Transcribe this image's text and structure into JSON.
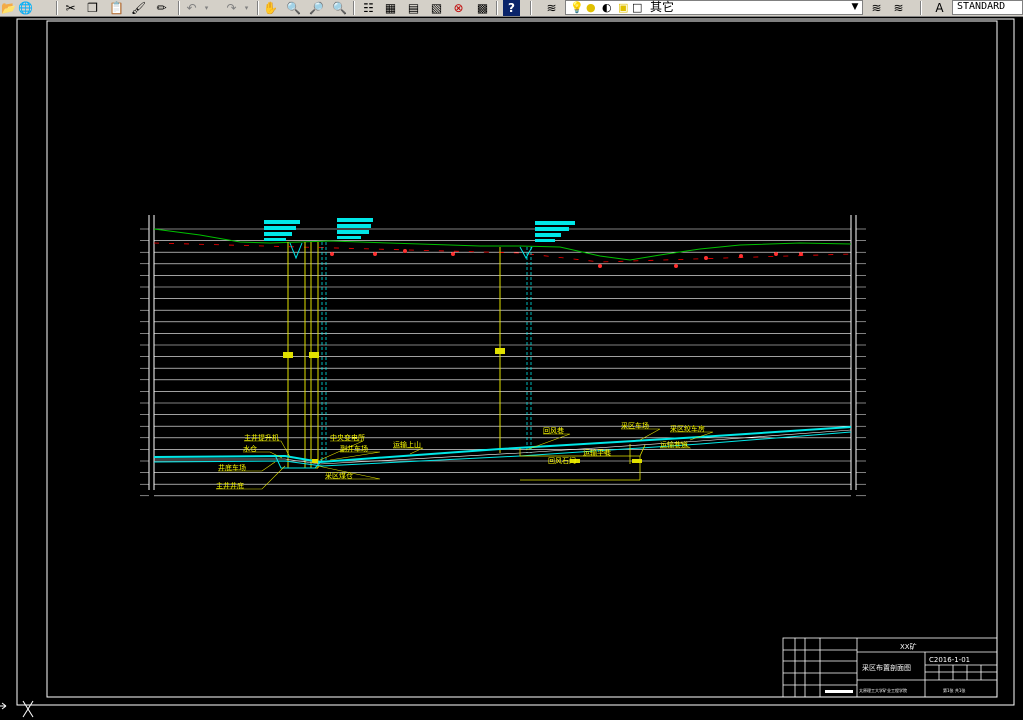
{
  "toolbar": {
    "layer_name": "其它",
    "text_style": "STANDARD"
  },
  "drawing": {
    "labels": {
      "l1": "主井提升机",
      "l2": "水仓",
      "l3": "井底车场",
      "l4": "主井井底",
      "l5": "中央变电所",
      "l6": "副井车场",
      "l7": "采区煤仓",
      "l8": "运输上山",
      "l9": "回风巷",
      "l10": "采区车场",
      "l11": "采区绞车房",
      "l12": "运输平巷",
      "l13": "运输巷道",
      "l14": "回风石门"
    },
    "title_block": {
      "company": "XX矿",
      "drawing_no": "C2016-1-01",
      "drawing_title": "采区布置剖面图",
      "design_unit": "太原理工大学矿业工程学院",
      "sheet": "第1张 共1张"
    }
  }
}
